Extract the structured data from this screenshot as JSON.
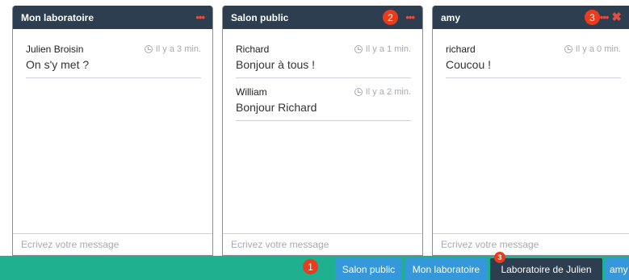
{
  "panels": [
    {
      "title": "Mon laboratoire",
      "messages": [
        {
          "author": "Julien Broisin",
          "time": "Il y a 3 min.",
          "text": "On s'y met ?"
        }
      ],
      "placeholder": "Ecrivez votre message"
    },
    {
      "title": "Salon public",
      "messages": [
        {
          "author": "Richard",
          "time": "Il y a 1 min.",
          "text": "Bonjour à tous !"
        },
        {
          "author": "William",
          "time": "Il y a 2 min.",
          "text": "Bonjour Richard"
        }
      ],
      "placeholder": "Ecrivez votre message"
    },
    {
      "title": "amy",
      "messages": [
        {
          "author": "richard",
          "time": "Il y a 0 min.",
          "text": "Coucou !"
        }
      ],
      "placeholder": "Ecrivez votre message"
    }
  ],
  "taskbar": {
    "tabs": [
      "Salon public",
      "Mon laboratoire",
      "Laboratoire de Julien",
      "amy"
    ],
    "tab_badge": "3"
  },
  "annotations": {
    "one": "1",
    "two": "2",
    "three": "3"
  },
  "menu_glyph": "•••",
  "close_glyph": "✖",
  "colors": {
    "header": "#2d3e50",
    "taskbar": "#1fb08f",
    "tab": "#3498db",
    "active_tab": "#2d3e50",
    "alert": "#e74c3c"
  }
}
